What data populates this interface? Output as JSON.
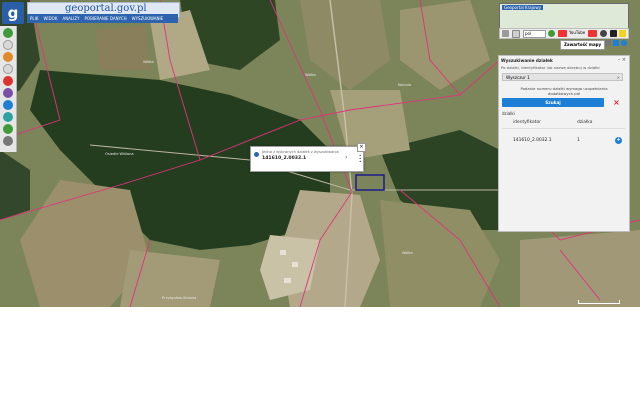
{
  "header": {
    "logo_letter": "g",
    "brand": "geoportal.gov.pl",
    "menu": [
      "PLIK",
      "WIDOK",
      "ANALIZY",
      "POBIERANIE DANYCH",
      "WYSZUKIWANIE"
    ]
  },
  "minimap": {
    "title": "Geoportal Krajowy"
  },
  "toolbar": {
    "select_value": "pol",
    "youtube_label": "YouTube",
    "youtube_label2": "YouTube"
  },
  "content_button": "Zawartość mapy",
  "panel": {
    "title": "Wyszukiwanie działek",
    "hint": "Po działki, identyfikator lub nazwę obrębu) w działki",
    "input_value": "Wyszczur 1",
    "note": "Podanie numeru działki wymaga uzupełnienia dodatkowych pól",
    "search_label": "Szukaj",
    "section_label": "działki",
    "columns": [
      "identyfikator",
      "działka"
    ],
    "rows": [
      {
        "id": "141610_2.0032.1",
        "nr": "1"
      }
    ]
  },
  "popup": {
    "line1": "Jedna z wybranych działek z wyszukiwania",
    "line2": "141610_2.0032.1"
  },
  "map_labels": {
    "l1": "Wólka",
    "l2": "Wólka",
    "l3": "Kolonia",
    "l4": "Osiedle Wiślana",
    "l5": "Wólka",
    "l6": "Przybysław-Kolonia"
  },
  "colors": {
    "accent": "#2e64ad",
    "button": "#1d7fd6",
    "parcel": "#1b1b8a",
    "boundary": "#e0327a"
  }
}
